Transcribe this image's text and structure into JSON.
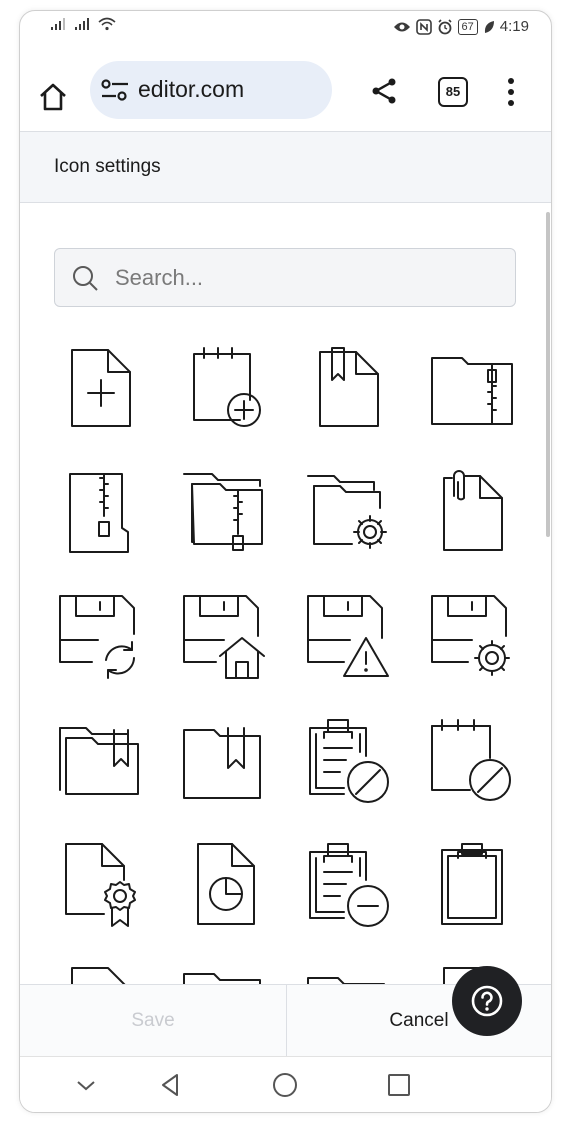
{
  "status_bar": {
    "time": "4:19",
    "battery": "67",
    "icons": [
      "signal-icon",
      "signal-icon",
      "wifi-icon",
      "eye-icon",
      "nfc-icon",
      "alarm-icon",
      "battery-icon",
      "leaf-icon"
    ]
  },
  "browser": {
    "url": "editor.com",
    "tab_count": "85"
  },
  "dialog": {
    "title": "Icon settings",
    "search_placeholder": "Search..."
  },
  "icons": [
    "file-plus-icon",
    "notepad-plus-icon",
    "file-bookmark-icon",
    "folder-zip-icon",
    "file-zip-icon",
    "folders-zip-icon",
    "folder-settings-icon",
    "file-paperclip-icon",
    "save-sync-icon",
    "save-home-icon",
    "save-warning-icon",
    "save-settings-icon",
    "folders-bookmark-icon",
    "folder-bookmark-icon",
    "clipboard-forbid-icon",
    "notepad-forbid-icon",
    "file-award-icon",
    "file-chart-pie-icon",
    "clipboard-minus-icon",
    "clipboard-icon"
  ],
  "footer": {
    "save_label": "Save",
    "cancel_label": "Cancel"
  }
}
